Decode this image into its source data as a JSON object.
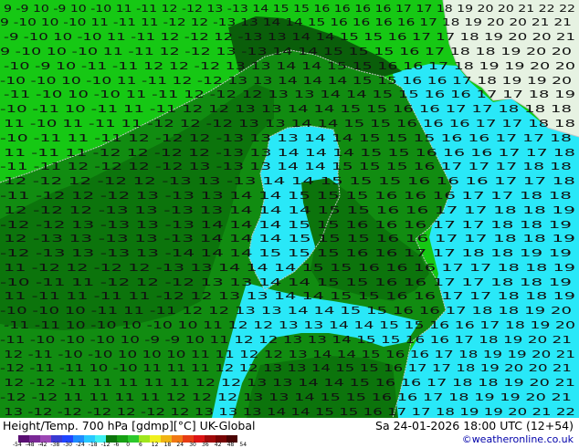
{
  "map": {
    "colors": {
      "sea_warm": "#16c814",
      "sea_warmer": "#1ab218",
      "land_green": "#118c11",
      "land_dark": "#0c740c",
      "land_darker": "#0a5e0a",
      "ridge": "#0f6a0f",
      "cyan": "#29e8f8",
      "cyan_light": "#5df0fc",
      "cold_land": "#e6f2e2",
      "contour": "#111111",
      "coast": "#c8c8c8"
    },
    "contour_rows": [
      {
        "text": "9 -9 10 -9 10 -10 11 -11 12 -12 13 -13 14 15 15 16 16 16 16 17 17 18 19 20 20 21 22 22"
      },
      {
        "text": "9 -10 10 -10 11 -11 11 -12 12 -13 13 14 14 15 16 16 16 16 17 18 19 20 20 21 21"
      },
      {
        "text": "-9 -10 10 -10 11 -11 12 -12 12 -13 13 14 14 15 15 16 17 17 18 19 20 20 21"
      },
      {
        "text": "9 -10 10 -10 11 -11 12 -12 13 -13 14 14 15 15 15 16 17 18 18 19 20 20"
      },
      {
        "text": "-10 -9 10 -11 -11 12 12 -12 13 13 14 14 15 15 16 16 17 18 19 19 20 20"
      },
      {
        "text": "-10 -10 10 -10 11 -11 12 -12 13 13 14 14 14 15 15 16 16 17 18 19 19 20"
      },
      {
        "text": "-11 -10 10 -10 11 -11 12 -12 12 13 13 14 14 15 15 16 16 17 17 18 19"
      },
      {
        "text": "-10 -11 10 -11 11 -11 12 12 13 13 14 14 15 15 16 16 17 17 18 18 18"
      },
      {
        "text": "11 -10 11 -11 11 -12 12 -12 13 13 14 14 15 15 16 16 16 17 17 18 18"
      },
      {
        "text": "-10 -11 11 -11 12 -12 12 -13 13 13 14 14 15 15 15 16 16 17 17 18"
      },
      {
        "text": "11 -11 11 -12 12 -12 12 -13 13 14 14 14 15 15 16 16 16 17 17 18"
      },
      {
        "text": "-11 -11 12 -12 12 -12 13 -13 13 14 14 15 15 15 16 17 17 17 18 18"
      },
      {
        "text": "12 -12 12 -12 12 -13 13 -13 14 14 15 15 15 16 16 16 17 17 18"
      },
      {
        "text": "-11 -12 12 -12 13 -13 13 14 14 15 15 15 16 16 16 17 17 18 18"
      },
      {
        "text": "12 -12 12 -13 13 -13 13 14 14 14 15 15 16 16 17 17 18 18 19"
      },
      {
        "text": "-12 -12 13 -13 13 -13 14 14 14 15 15 16 16 16 17 17 18 18 19"
      },
      {
        "text": "12 -13 13 -13 13 -13 14 14 14 15 15 15 16 16 17 17 18 18 19"
      },
      {
        "text": "-12 -13 13 -13 13 -14 14 14 15 15 15 16 16 17 17 18 18 19 19"
      },
      {
        "text": "11 -12 12 -12 12 -13 13 14 14 14 15 15 16 16 16 17 17 18 18 19"
      },
      {
        "text": "-10 -11 11 -12 12 -12 13 13 14 14 15 15 16 16 17 17 18 18 19"
      },
      {
        "text": "11 -11 11 -11 11 -12 12 13 13 14 14 15 15 16 16 17 17 18 18 19"
      },
      {
        "text": "-10 -10 10 -11 11 -11 12 12 13 13 14 14 15 15 16 16 17 18 18 19 20"
      },
      {
        "text": "-11 -11 10 -10 10 -10 10 11 12 12 13 13 14 14 15 15 16 16 17 18 19 20"
      },
      {
        "text": "-11 -10 -10 -10 10 -9 -9 10 11 12 12 13 13 14 15 15 16 16 17 18 19 20 21"
      },
      {
        "text": "12 -11 -10 -10 10 10 10 11 11 12 12 13 14 14 15 16 16 17 18 19 19 20 21"
      },
      {
        "text": "-12 -11 -11 10 -10 11 11 11 12 12 13 13 14 15 15 16 17 17 18 19 20 20 21"
      },
      {
        "text": "12 -12 -11 11 11 11 11 12 12 13 13 14 14 15 16 16 17 18 18 19 20 21"
      },
      {
        "text": "-12 -12 11 11 11 11 12 12 12 13 13 14 15 15 16 16 17 18 19 19 20 21"
      },
      {
        "text": "13 -12 -12 -12 12 -12 12 13 13 13 14 14 15 15 16 17 17 18 19 19 20 21 22"
      }
    ],
    "place_labels": [
      {
        "text": "13"
      },
      {
        "text": "15"
      }
    ]
  },
  "footer": {
    "title": "Height/Temp. 700 hPa [gdmp][°C] UK-Global",
    "time": "Sa 24-01-2026 18:00 UTC (12+54)",
    "credit": "©weatheronline.co.uk",
    "colorbar": {
      "colors": [
        "#5a0f73",
        "#7a2896",
        "#9b46b4",
        "#3a3ad2",
        "#2046ff",
        "#1e8cff",
        "#28c8ff",
        "#40f0f0",
        "#0c740c",
        "#16a014",
        "#2cc82c",
        "#a0e61e",
        "#f0f01e",
        "#f0b414",
        "#f07814",
        "#e63c14",
        "#dc1414",
        "#a00a0a",
        "#780505",
        "#4a0303"
      ],
      "labels": [
        "-54",
        "-48",
        "-42",
        "-38",
        "-30",
        "-24",
        "-18",
        "-12",
        "-6",
        "0",
        "6",
        "12",
        "18",
        "24",
        "30",
        "36",
        "42",
        "48",
        "54"
      ]
    }
  }
}
